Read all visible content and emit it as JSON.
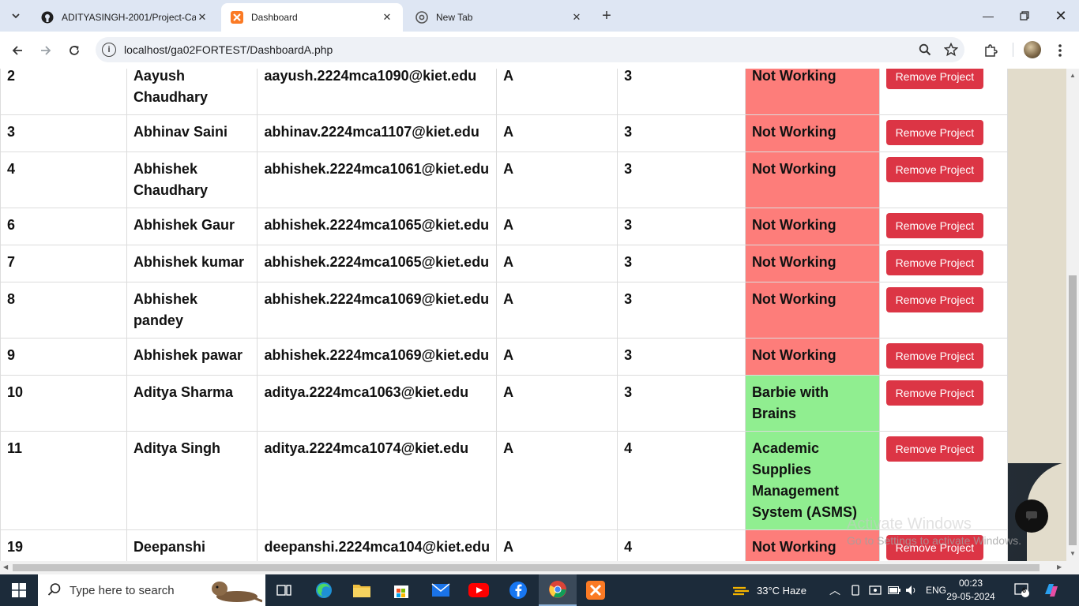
{
  "browser": {
    "tabs": [
      {
        "title": "ADITYASINGH-2001/Project-Ca",
        "active": false
      },
      {
        "title": "Dashboard",
        "active": true
      },
      {
        "title": "New Tab",
        "active": false
      }
    ],
    "url": "localhost/ga02FORTEST/DashboardA.php"
  },
  "table": {
    "rows": [
      {
        "id": "2",
        "name": "Aayush Chaudhary",
        "email": "aayush.2224mca1090@kiet.edu",
        "section": "A",
        "semester": "3",
        "project": "Not Working",
        "status": "red",
        "action": "Remove Project"
      },
      {
        "id": "3",
        "name": "Abhinav Saini",
        "email": "abhinav.2224mca1107@kiet.edu",
        "section": "A",
        "semester": "3",
        "project": "Not Working",
        "status": "red",
        "action": "Remove Project"
      },
      {
        "id": "4",
        "name": "Abhishek Chaudhary",
        "email": "abhishek.2224mca1061@kiet.edu",
        "section": "A",
        "semester": "3",
        "project": "Not Working",
        "status": "red",
        "action": "Remove Project"
      },
      {
        "id": "6",
        "name": "Abhishek Gaur",
        "email": "abhishek.2224mca1065@kiet.edu",
        "section": "A",
        "semester": "3",
        "project": "Not Working",
        "status": "red",
        "action": "Remove Project"
      },
      {
        "id": "7",
        "name": "Abhishek kumar",
        "email": "abhishek.2224mca1065@kiet.edu",
        "section": "A",
        "semester": "3",
        "project": "Not Working",
        "status": "red",
        "action": "Remove Project"
      },
      {
        "id": "8",
        "name": "Abhishek pandey",
        "email": "abhishek.2224mca1069@kiet.edu",
        "section": "A",
        "semester": "3",
        "project": "Not Working",
        "status": "red",
        "action": "Remove Project"
      },
      {
        "id": "9",
        "name": "Abhishek pawar",
        "email": "abhishek.2224mca1069@kiet.edu",
        "section": "A",
        "semester": "3",
        "project": "Not Working",
        "status": "red",
        "action": "Remove Project"
      },
      {
        "id": "10",
        "name": "Aditya Sharma",
        "email": "aditya.2224mca1063@kiet.edu",
        "section": "A",
        "semester": "3",
        "project": "Barbie with Brains",
        "status": "green",
        "action": "Remove Project"
      },
      {
        "id": "11",
        "name": "Aditya Singh",
        "email": "aditya.2224mca1074@kiet.edu",
        "section": "A",
        "semester": "4",
        "project": "Academic Supplies Management System (ASMS)",
        "status": "green",
        "action": "Remove Project"
      },
      {
        "id": "19",
        "name": "Deepanshi Sharma",
        "email": "deepanshi.2224mca104@kiet.edu",
        "section": "A",
        "semester": "4",
        "project": "Not Working",
        "status": "red",
        "action": "Remove Project"
      }
    ]
  },
  "watermark": {
    "line1": "Activate Windows",
    "line2": "Go to Settings to activate Windows."
  },
  "taskbar": {
    "search_placeholder": "Type here to search",
    "weather": "33°C  Haze",
    "language": "ENG",
    "time": "00:23",
    "date": "29-05-2024",
    "notification_count": "6"
  },
  "colors": {
    "status_red": "#fd7d7a",
    "status_green": "#90ee90",
    "button_red": "#dc3545"
  }
}
